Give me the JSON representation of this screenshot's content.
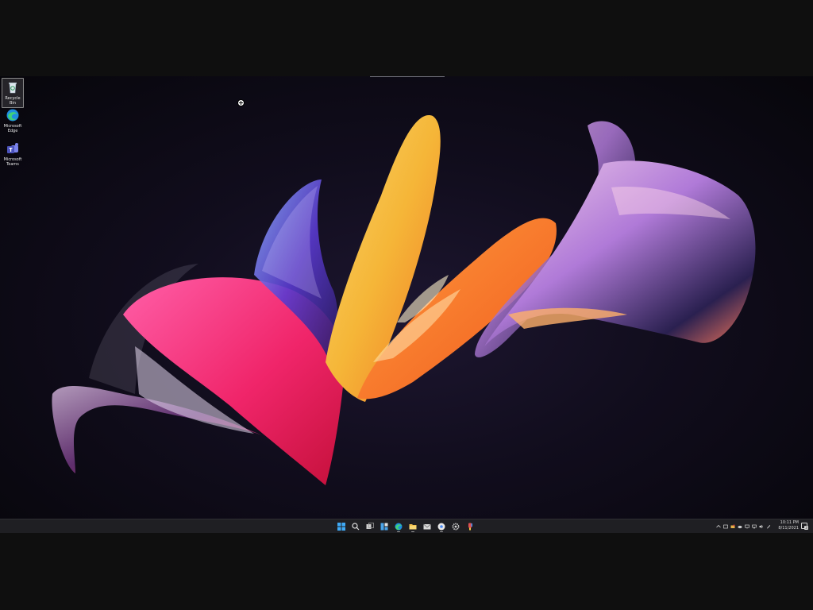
{
  "desktop": {
    "icons": [
      {
        "label": "Recycle Bin",
        "icon": "recycle-bin-icon"
      },
      {
        "label": "Microsoft Edge",
        "icon": "edge-icon"
      },
      {
        "label": "Microsoft Teams",
        "icon": "teams-icon"
      }
    ]
  },
  "taskbar": {
    "pinned": [
      {
        "name": "start",
        "icon": "windows-logo-icon"
      },
      {
        "name": "search",
        "icon": "search-icon"
      },
      {
        "name": "task-view",
        "icon": "task-view-icon"
      },
      {
        "name": "widgets",
        "icon": "widgets-icon"
      },
      {
        "name": "edge",
        "icon": "edge-icon"
      },
      {
        "name": "file-explorer",
        "icon": "folder-icon"
      },
      {
        "name": "mail",
        "icon": "mail-icon"
      },
      {
        "name": "chrome",
        "icon": "chrome-icon"
      },
      {
        "name": "settings",
        "icon": "gear-icon"
      },
      {
        "name": "paint",
        "icon": "paint-icon"
      }
    ],
    "tray": {
      "time": "10:11 PM",
      "date": "8/11/2021",
      "notification_count": "3"
    }
  },
  "colors": {
    "taskbar_bg": "#1f1f23",
    "wallpaper_bg": "#110d1d",
    "accent": "#0078d4"
  }
}
